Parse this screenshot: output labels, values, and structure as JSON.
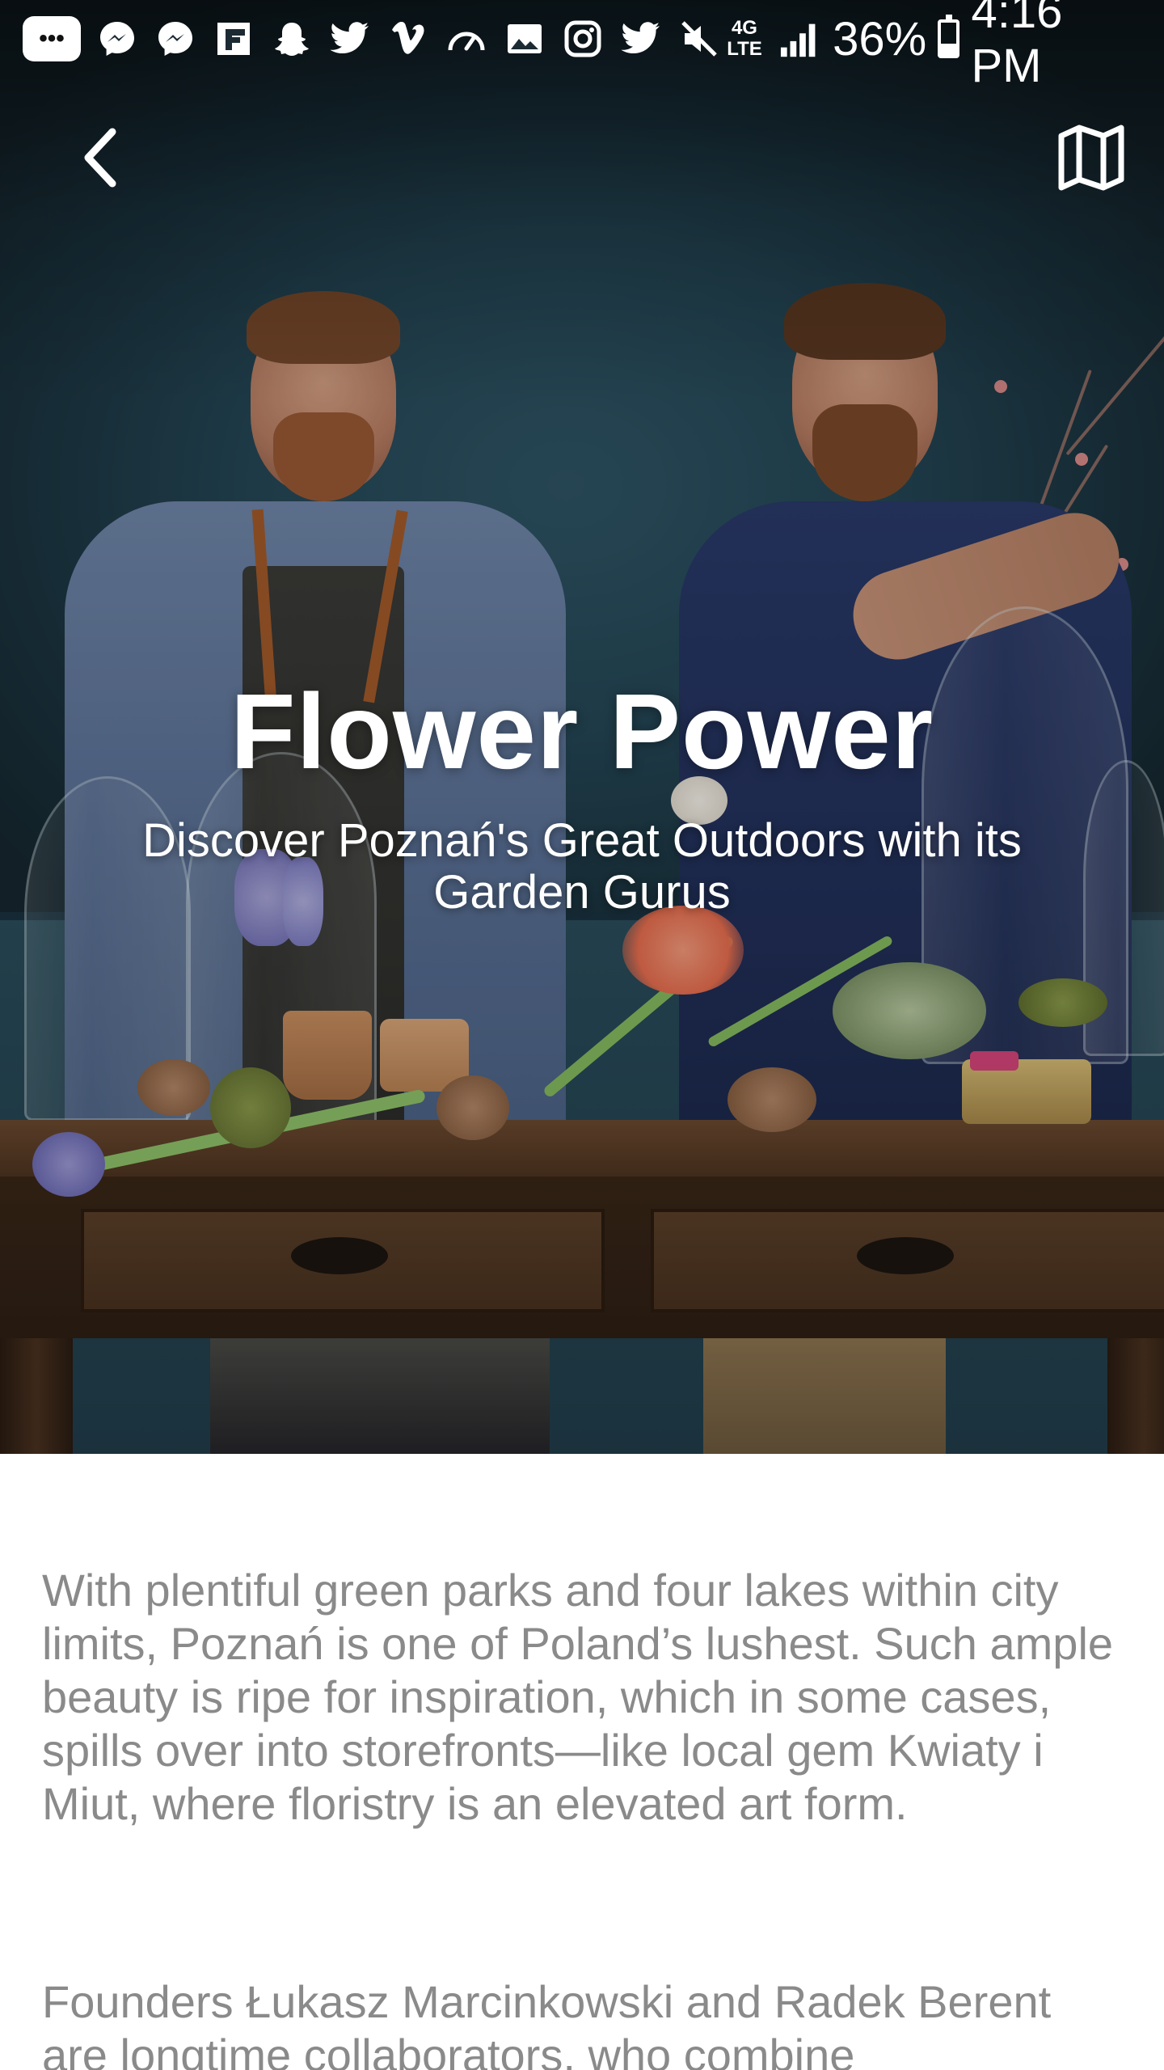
{
  "status_bar": {
    "notification_icons": [
      "more-messages-icon",
      "messenger-icon",
      "messenger-icon",
      "flipboard-icon",
      "snapchat-icon",
      "twitter-icon",
      "vimeo-icon",
      "speedometer-icon",
      "gallery-icon",
      "instagram-icon",
      "twitter-icon",
      "mute-icon"
    ],
    "network": "4G LTE",
    "battery_percent": "36%",
    "battery_level": 0.36,
    "time": "4:16 PM"
  },
  "nav": {
    "back_icon": "chevron-left-icon",
    "map_icon": "map-icon"
  },
  "hero": {
    "title": "Flower Power",
    "subtitle": "Discover Poznań's Great Outdoors with its Garden Gurus"
  },
  "article": {
    "paragraphs": [
      "With plentiful green parks and four lakes within city limits, Poznań is one of Poland’s lushest. Such ample beauty is ripe for inspiration, which in some cases, spills over into storefronts—like local gem Kwiaty i Miut, where floristry is an elevated art form.",
      "Founders Łukasz Marcinkowski and Radek Berent are longtime collaborators, who combine"
    ]
  },
  "colors": {
    "hero_text": "#ffffff",
    "body_text": "#8a8a8a",
    "background": "#ffffff"
  }
}
